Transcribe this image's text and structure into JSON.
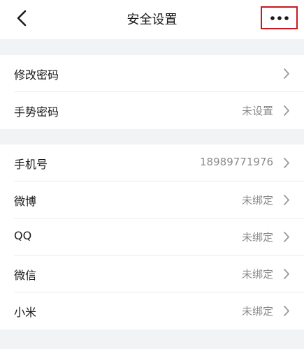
{
  "header": {
    "title": "安全设置",
    "back_icon": "chevron-left-icon",
    "more_icon": "more-horizontal-icon",
    "highlight_color": "#c8181e"
  },
  "section_password": {
    "rows": [
      {
        "label": "修改密码",
        "value": ""
      },
      {
        "label": "手势密码",
        "value": "未设置"
      }
    ]
  },
  "section_accounts": {
    "rows": [
      {
        "label": "手机号",
        "value": "18989771976"
      },
      {
        "label": "微博",
        "value": "未绑定"
      },
      {
        "label": "QQ",
        "value": "未绑定"
      },
      {
        "label": "微信",
        "value": "未绑定"
      },
      {
        "label": "小米",
        "value": "未绑定"
      }
    ]
  }
}
